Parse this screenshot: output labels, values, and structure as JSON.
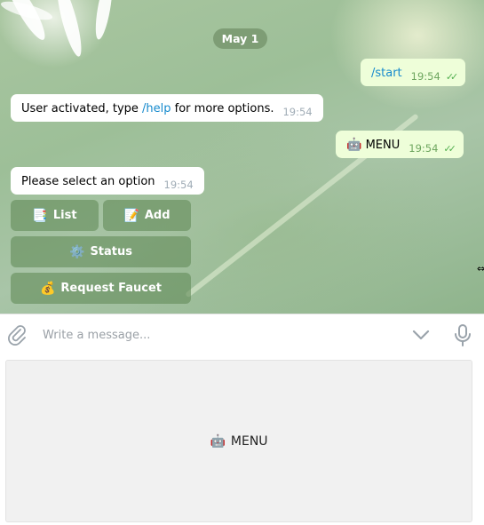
{
  "chat": {
    "date": "May 1",
    "messages": [
      {
        "direction": "out",
        "text": "/start",
        "time": "19:54"
      },
      {
        "direction": "in",
        "text_prefix": "User activated, type ",
        "link": "/help",
        "text_suffix": " for more options.",
        "time": "19:54"
      },
      {
        "direction": "out",
        "emoji": "🤖",
        "text": "MENU",
        "time": "19:54"
      },
      {
        "direction": "in",
        "text": "Please select an option",
        "time": "19:54"
      }
    ],
    "inline_keyboard": [
      {
        "emoji": "📑",
        "label": "List"
      },
      {
        "emoji": "📝",
        "label": "Add"
      },
      {
        "emoji": "⚙️",
        "label": "Status"
      },
      {
        "emoji": "💰",
        "label": "Request Faucet"
      }
    ]
  },
  "composer": {
    "placeholder": "Write a message..."
  },
  "reply_keyboard": {
    "emoji": "🤖",
    "label": "MENU"
  },
  "icons": {
    "attach": "paperclip-icon",
    "collapse": "chevron-down-icon",
    "voice": "microphone-icon",
    "read": "double-check-icon"
  },
  "colors": {
    "incoming_bubble": "#ffffff",
    "outgoing_bubble": "#eefed9",
    "link": "#168acd",
    "read_ticks": "#53b050",
    "keyboard_button": "#6b8f60"
  }
}
